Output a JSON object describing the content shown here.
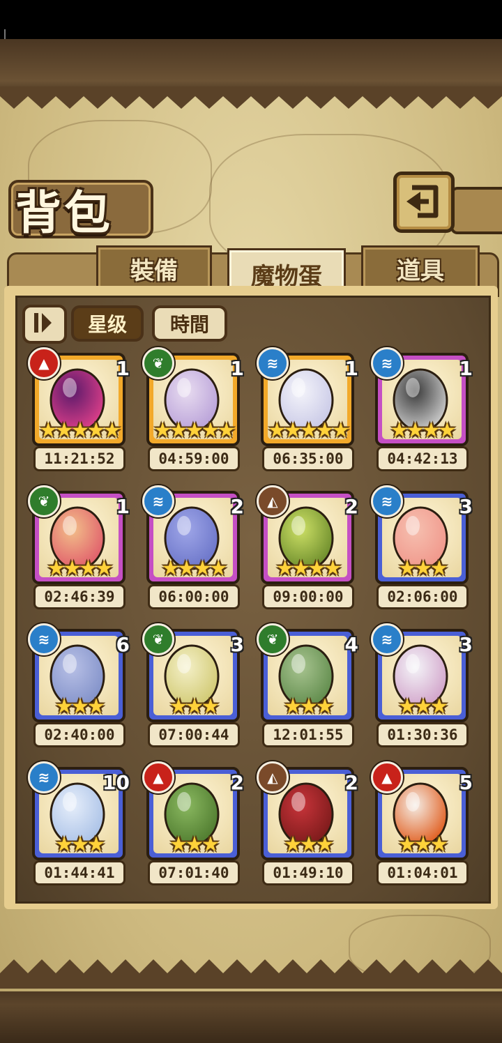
{
  "header": {
    "title": "背包"
  },
  "tabs": [
    {
      "label": "裝備",
      "active": false
    },
    {
      "label": "魔物蛋",
      "active": true
    },
    {
      "label": "道具",
      "active": false
    }
  ],
  "sort": {
    "star_label": "星级",
    "time_label": "時間",
    "selected": "星级"
  },
  "colors": {
    "fire": "#c8221a",
    "leaf": "#2f7d2c",
    "water": "#2a7fc9",
    "earth": "#7a4a2a",
    "gold": "#f2a92a",
    "purple": "#c54fc4",
    "blue": "#4a5fd6"
  },
  "eggs": [
    {
      "element": "fire",
      "count": "1",
      "stars": "★★★★★",
      "timer": "11:21:52",
      "rarity": "gold"
    },
    {
      "element": "leaf",
      "count": "1",
      "stars": "★★★★★",
      "timer": "04:59:00",
      "rarity": "gold"
    },
    {
      "element": "water",
      "count": "1",
      "stars": "★★★★★",
      "timer": "06:35:00",
      "rarity": "gold"
    },
    {
      "element": "water",
      "count": "1",
      "stars": "★★★★",
      "timer": "04:42:13",
      "rarity": "purple"
    },
    {
      "element": "leaf",
      "count": "1",
      "stars": "★★★★",
      "timer": "02:46:39",
      "rarity": "purple"
    },
    {
      "element": "water",
      "count": "2",
      "stars": "★★★★",
      "timer": "06:00:00",
      "rarity": "purple"
    },
    {
      "element": "earth",
      "count": "2",
      "stars": "★★★★",
      "timer": "09:00:00",
      "rarity": "purple"
    },
    {
      "element": "water",
      "count": "3",
      "stars": "★★★",
      "timer": "02:06:00",
      "rarity": "blue"
    },
    {
      "element": "water",
      "count": "6",
      "stars": "★★★",
      "timer": "02:40:00",
      "rarity": "blue"
    },
    {
      "element": "leaf",
      "count": "3",
      "stars": "★★★",
      "timer": "07:00:44",
      "rarity": "blue"
    },
    {
      "element": "leaf",
      "count": "4",
      "stars": "★★★",
      "timer": "12:01:55",
      "rarity": "blue"
    },
    {
      "element": "water",
      "count": "3",
      "stars": "★★★",
      "timer": "01:30:36",
      "rarity": "blue"
    },
    {
      "element": "water",
      "count": "10",
      "stars": "★★★",
      "timer": "01:44:41",
      "rarity": "blue"
    },
    {
      "element": "fire",
      "count": "2",
      "stars": "★★★",
      "timer": "07:01:40",
      "rarity": "blue"
    },
    {
      "element": "earth",
      "count": "2",
      "stars": "★★★",
      "timer": "01:49:10",
      "rarity": "blue"
    },
    {
      "element": "fire",
      "count": "5",
      "stars": "★★★",
      "timer": "01:04:01",
      "rarity": "blue"
    }
  ]
}
